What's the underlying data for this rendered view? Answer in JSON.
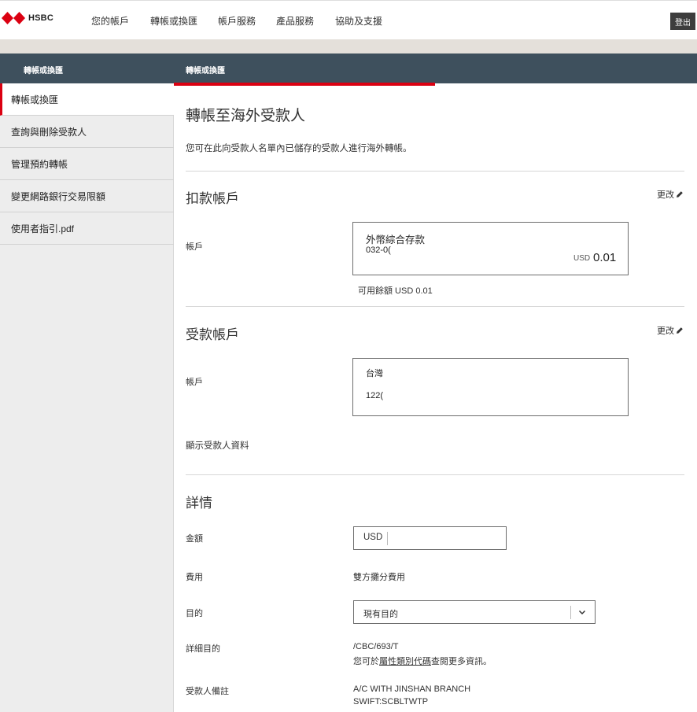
{
  "header": {
    "brand": "HSBC",
    "nav": [
      "您的帳戶",
      "轉帳或換匯",
      "帳戶服務",
      "產品服務",
      "協助及支援"
    ],
    "logout": "登出"
  },
  "band": {
    "left_title": "轉帳或換匯",
    "right_title": "轉帳或換匯"
  },
  "sidebar": {
    "items": [
      {
        "label": "轉帳或換匯"
      },
      {
        "label": "查詢與刪除受款人"
      },
      {
        "label": "管理預約轉帳"
      },
      {
        "label": "變更網路銀行交易限額"
      },
      {
        "label": "使用者指引.pdf"
      }
    ]
  },
  "main": {
    "title": "轉帳至海外受款人",
    "description": "您可在此向受款人名單內已儲存的受款人進行海外轉帳。",
    "debit": {
      "section_title": "扣款帳戶",
      "edit": "更改",
      "label": "帳戶",
      "account_name": "外幣綜合存款",
      "account_number": "032-0(",
      "currency": "USD",
      "balance": "0.01",
      "available": "可用餘額 USD 0.01"
    },
    "payee": {
      "section_title": "受款帳戶",
      "edit": "更改",
      "label": "帳戶",
      "line1": "台灣",
      "line2": "122(",
      "show_details": "顯示受款人資料"
    },
    "details": {
      "section_title": "詳情",
      "amount_label": "金額",
      "amount_currency": "USD",
      "fee_label": "費用",
      "fee_value": "雙方攤分費用",
      "purpose_label": "目的",
      "purpose_value": "現有目的",
      "detailed_purpose_label": "詳細目的",
      "detailed_purpose_code": "/CBC/693/T",
      "detailed_purpose_note_pre": "您可於",
      "detailed_purpose_note_link": "屬性類別代碼",
      "detailed_purpose_note_post": "查閱更多資訊。",
      "payee_note_label": "受款人備註",
      "payee_note_line1": "A/C WITH JINSHAN BRANCH",
      "payee_note_line2": "SWIFT:SCBLTWTP"
    }
  },
  "colors": {
    "brand_red": "#db0011",
    "header_band": "#3e505d",
    "sidebar_bg": "#ededed"
  }
}
